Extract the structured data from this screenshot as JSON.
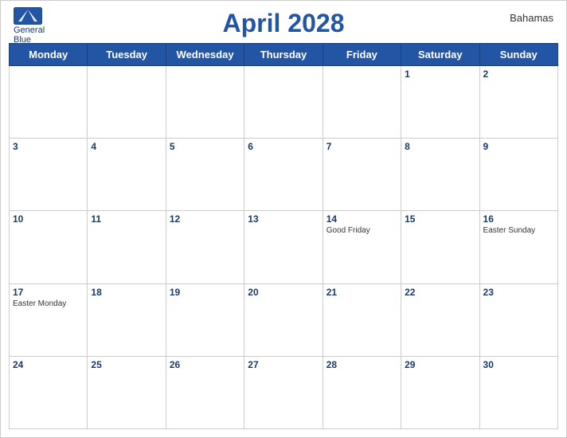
{
  "header": {
    "title": "April 2028",
    "country": "Bahamas",
    "logo_line1": "General",
    "logo_line2": "Blue"
  },
  "weekdays": [
    "Monday",
    "Tuesday",
    "Wednesday",
    "Thursday",
    "Friday",
    "Saturday",
    "Sunday"
  ],
  "weeks": [
    [
      {
        "day": "",
        "holiday": ""
      },
      {
        "day": "",
        "holiday": ""
      },
      {
        "day": "",
        "holiday": ""
      },
      {
        "day": "",
        "holiday": ""
      },
      {
        "day": "",
        "holiday": ""
      },
      {
        "day": "1",
        "holiday": ""
      },
      {
        "day": "2",
        "holiday": ""
      }
    ],
    [
      {
        "day": "3",
        "holiday": ""
      },
      {
        "day": "4",
        "holiday": ""
      },
      {
        "day": "5",
        "holiday": ""
      },
      {
        "day": "6",
        "holiday": ""
      },
      {
        "day": "7",
        "holiday": ""
      },
      {
        "day": "8",
        "holiday": ""
      },
      {
        "day": "9",
        "holiday": ""
      }
    ],
    [
      {
        "day": "10",
        "holiday": ""
      },
      {
        "day": "11",
        "holiday": ""
      },
      {
        "day": "12",
        "holiday": ""
      },
      {
        "day": "13",
        "holiday": ""
      },
      {
        "day": "14",
        "holiday": "Good Friday"
      },
      {
        "day": "15",
        "holiday": ""
      },
      {
        "day": "16",
        "holiday": "Easter Sunday"
      }
    ],
    [
      {
        "day": "17",
        "holiday": "Easter Monday"
      },
      {
        "day": "18",
        "holiday": ""
      },
      {
        "day": "19",
        "holiday": ""
      },
      {
        "day": "20",
        "holiday": ""
      },
      {
        "day": "21",
        "holiday": ""
      },
      {
        "day": "22",
        "holiday": ""
      },
      {
        "day": "23",
        "holiday": ""
      }
    ],
    [
      {
        "day": "24",
        "holiday": ""
      },
      {
        "day": "25",
        "holiday": ""
      },
      {
        "day": "26",
        "holiday": ""
      },
      {
        "day": "27",
        "holiday": ""
      },
      {
        "day": "28",
        "holiday": ""
      },
      {
        "day": "29",
        "holiday": ""
      },
      {
        "day": "30",
        "holiday": ""
      }
    ]
  ]
}
